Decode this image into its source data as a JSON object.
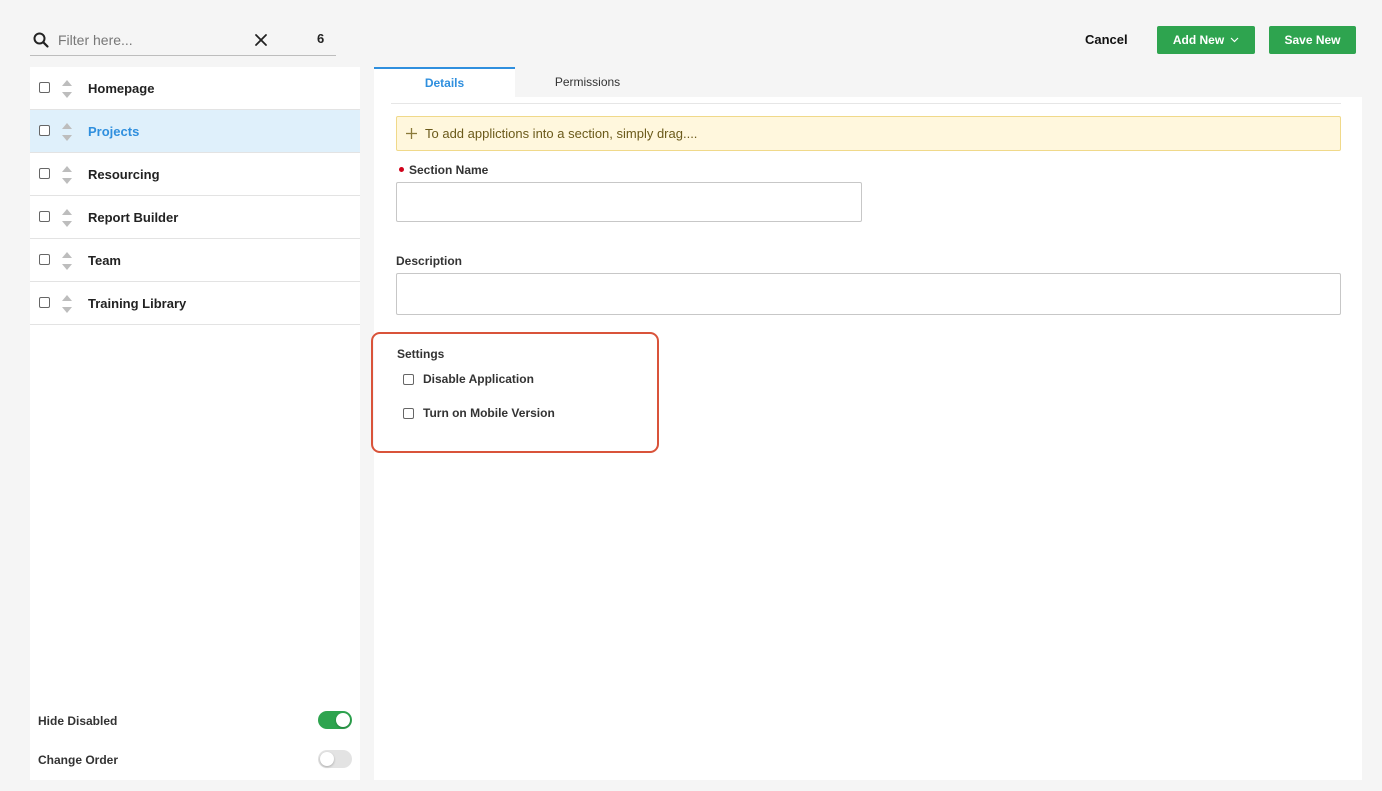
{
  "filter": {
    "placeholder": "Filter here...",
    "count": "6"
  },
  "sidebar": {
    "items": [
      {
        "label": "Homepage",
        "active": false
      },
      {
        "label": "Projects",
        "active": true
      },
      {
        "label": "Resourcing",
        "active": false
      },
      {
        "label": "Report Builder",
        "active": false
      },
      {
        "label": "Team",
        "active": false
      },
      {
        "label": "Training Library",
        "active": false
      }
    ],
    "hide_disabled": {
      "label": "Hide Disabled",
      "on": true
    },
    "change_order": {
      "label": "Change Order",
      "on": false
    }
  },
  "header": {
    "cancel_label": "Cancel",
    "add_new_label": "Add New",
    "save_new_label": "Save New"
  },
  "tabs": [
    {
      "label": "Details",
      "active": true
    },
    {
      "label": "Permissions",
      "active": false
    }
  ],
  "form": {
    "banner_text": "To add applictions into a section, simply drag....",
    "section_name_label": "Section Name",
    "section_name_value": "",
    "description_label": "Description",
    "description_value": "",
    "settings_title": "Settings",
    "disable_application_label": "Disable Application",
    "mobile_version_label": "Turn on Mobile Version"
  },
  "colors": {
    "accent_blue": "#2f8fde",
    "primary_green": "#2ea44f",
    "highlight_red": "#d9533a",
    "required_red": "#d0021b",
    "banner_bg": "#fff7dd"
  },
  "icons": {
    "search": "search-icon",
    "clear": "close-icon",
    "sort": "sort-arrows-icon",
    "add_new_chevron": "chevron-down-icon",
    "banner_plus": "plus-icon"
  }
}
